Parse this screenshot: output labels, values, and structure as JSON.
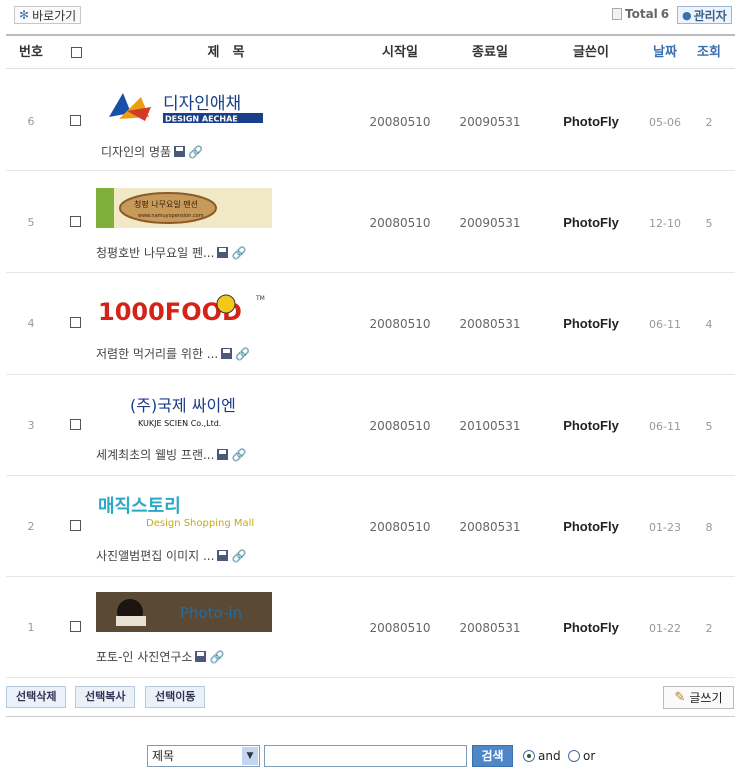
{
  "toolbar": {
    "shortcut_label": "바로가기",
    "total_label": "Total",
    "total_count": "6",
    "admin_label": "관리자"
  },
  "columns": {
    "number": "번호",
    "subject": "제　목",
    "start_date": "시작일",
    "end_date": "종료일",
    "writer": "글쓴이",
    "date": "날짜",
    "views": "조회"
  },
  "rows": [
    {
      "no": "6",
      "logo": "디자인애채",
      "title": "디자인의 명품",
      "start": "20080510",
      "end": "20090531",
      "writer": "PhotoFly",
      "date": "05-06",
      "views": "2"
    },
    {
      "no": "5",
      "logo": "청평나무요일",
      "title": "청평호반 나무요일 펜...",
      "start": "20080510",
      "end": "20090531",
      "writer": "PhotoFly",
      "date": "12-10",
      "views": "5"
    },
    {
      "no": "4",
      "logo": "1000FOOD",
      "title": "저렴한 먹거리를 위한 ...",
      "start": "20080510",
      "end": "20080531",
      "writer": "PhotoFly",
      "date": "06-11",
      "views": "4"
    },
    {
      "no": "3",
      "logo": "(주)국제 싸이엔",
      "title": "세계최초의 웰빙 프랜...",
      "start": "20080510",
      "end": "20100531",
      "writer": "PhotoFly",
      "date": "06-11",
      "views": "5"
    },
    {
      "no": "2",
      "logo": "매직스토리",
      "title": "사진앨범편집 이미지 ...",
      "start": "20080510",
      "end": "20080531",
      "writer": "PhotoFly",
      "date": "01-23",
      "views": "8"
    },
    {
      "no": "1",
      "logo": "Photo-in",
      "title": "포토-인 사진연구소",
      "start": "20080510",
      "end": "20080531",
      "writer": "PhotoFly",
      "date": "01-22",
      "views": "2"
    }
  ],
  "logos": {
    "design": {
      "top": "디자인애채",
      "bottom": "DESIGN AECHAE"
    },
    "pension": {
      "text": "청평 나무요일 펜션",
      "sub": "www.namuyopension.com"
    },
    "food": {
      "text": "1000FOOD",
      "tm": "TM"
    },
    "kukje": {
      "top": "(주)국제 싸이엔",
      "bottom": "KUKJE SCIEN Co.,Ltd."
    },
    "magic": {
      "top": "매직스토리",
      "bottom": "Design Shopping Mall"
    },
    "photoin": {
      "text": "Photo-in"
    }
  },
  "actions": {
    "delete_selected": "선택삭제",
    "copy_selected": "선택복사",
    "move_selected": "선택이동",
    "write": "글쓰기"
  },
  "search": {
    "field_selected": "제목",
    "query": "",
    "button": "검색",
    "and_label": "and",
    "or_label": "or",
    "and_checked": true
  },
  "colors": {
    "accent": "#3a6fb0",
    "search_button": "#4f86c8"
  }
}
